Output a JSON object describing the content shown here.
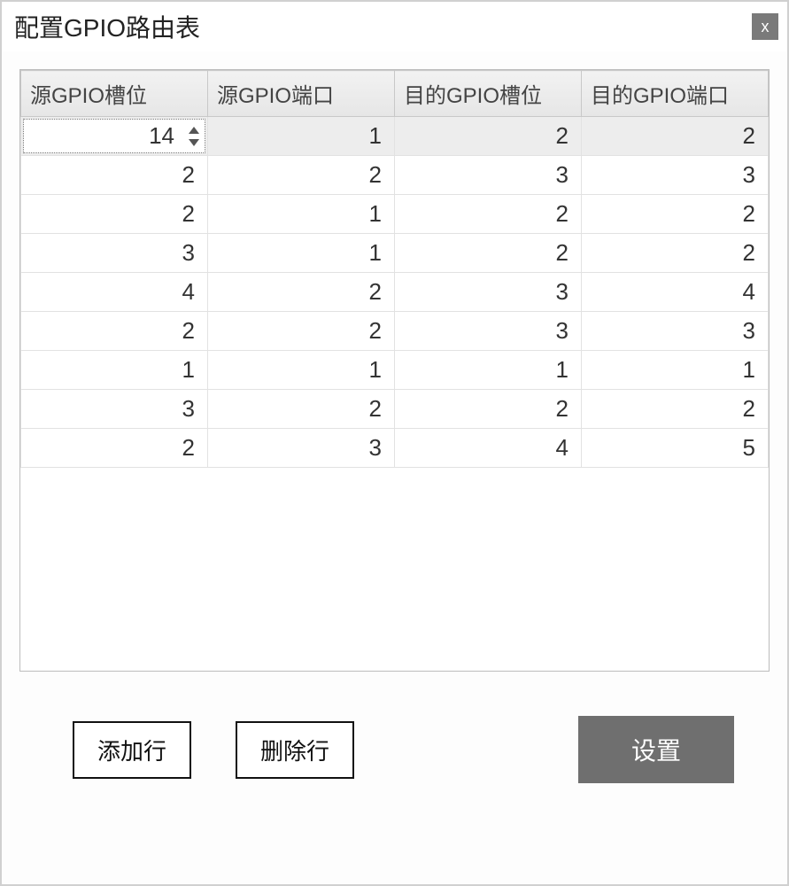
{
  "dialog": {
    "title": "配置GPIO路由表",
    "close_label": "x"
  },
  "table": {
    "headers": [
      "源GPIO槽位",
      "源GPIO端口",
      "目的GPIO槽位",
      "目的GPIO端口"
    ],
    "spinner_value": "14",
    "rows": [
      {
        "selected": true,
        "cells": [
          "14",
          "1",
          "2",
          "2"
        ],
        "spinner_col": 0
      },
      {
        "selected": false,
        "cells": [
          "2",
          "2",
          "3",
          "3"
        ]
      },
      {
        "selected": false,
        "cells": [
          "2",
          "1",
          "2",
          "2"
        ]
      },
      {
        "selected": false,
        "cells": [
          "3",
          "1",
          "2",
          "2"
        ]
      },
      {
        "selected": false,
        "cells": [
          "4",
          "2",
          "3",
          "4"
        ]
      },
      {
        "selected": false,
        "cells": [
          "2",
          "2",
          "3",
          "3"
        ]
      },
      {
        "selected": false,
        "cells": [
          "1",
          "1",
          "1",
          "1"
        ]
      },
      {
        "selected": false,
        "cells": [
          "3",
          "2",
          "2",
          "2"
        ]
      },
      {
        "selected": false,
        "cells": [
          "2",
          "3",
          "4",
          "5"
        ]
      }
    ]
  },
  "buttons": {
    "add_row": "添加行",
    "delete_row": "删除行",
    "apply": "设置"
  }
}
